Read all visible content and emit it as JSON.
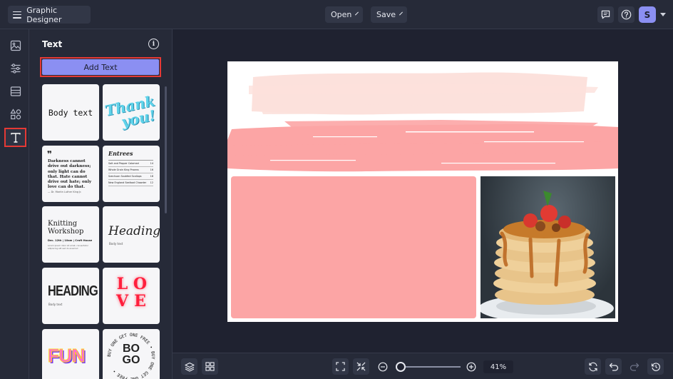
{
  "app": {
    "title": "Graphic Designer"
  },
  "toolbar": {
    "open_label": "Open",
    "save_label": "Save",
    "user_initial": "S"
  },
  "rail": {
    "items": [
      {
        "icon": "image-icon"
      },
      {
        "icon": "sliders-icon"
      },
      {
        "icon": "layout-icon"
      },
      {
        "icon": "shapes-icon"
      },
      {
        "icon": "text-icon",
        "active": true
      }
    ]
  },
  "panel": {
    "title": "Text",
    "add_text_label": "Add Text",
    "tiles": {
      "body_text": "Body text",
      "thank_you": [
        "Thank",
        "you!"
      ],
      "quote": {
        "mark": "❞",
        "text": "Darkness cannot drive out darkness; only light can do that. Hate cannot drive out hate; only love can do that.",
        "author": "— Dr. Martin Luther King Jr."
      },
      "menu": {
        "title": "Entrees",
        "rows": [
          [
            "Salt and Pepper Calamari",
            "14"
          ],
          [
            "Whole Grain King Prawns",
            "16"
          ],
          [
            "Szechuan Sautéed Scallops",
            "18"
          ],
          [
            "New England Seafood Chowder",
            "12"
          ]
        ]
      },
      "workshop": {
        "title_line1": "Knitting",
        "title_line2": "Workshop",
        "details": "Dec. 12th | 10am | Craft House",
        "small": "Lorem ipsum dolor sit amet, consectetur adipiscing elit sed do eiusmod"
      },
      "heading_script": {
        "title": "Heading",
        "sub": "Body text"
      },
      "heading_bold": {
        "title": "HEADING",
        "sub": "Body text"
      },
      "love": [
        "L",
        "O",
        "V",
        "E"
      ],
      "fun": "FUN",
      "bogo": {
        "line1": "BO",
        "line2": "GO",
        "ring": "BUY ONE GET ONE FREE • BUY ONE GET ONE FREE • "
      }
    }
  },
  "bottom": {
    "zoom_label": "41%"
  },
  "colors": {
    "accent": "#8b8ff2",
    "highlight": "#e53935",
    "brush_light": "#fce1dc",
    "brush": "#fca5a5"
  }
}
